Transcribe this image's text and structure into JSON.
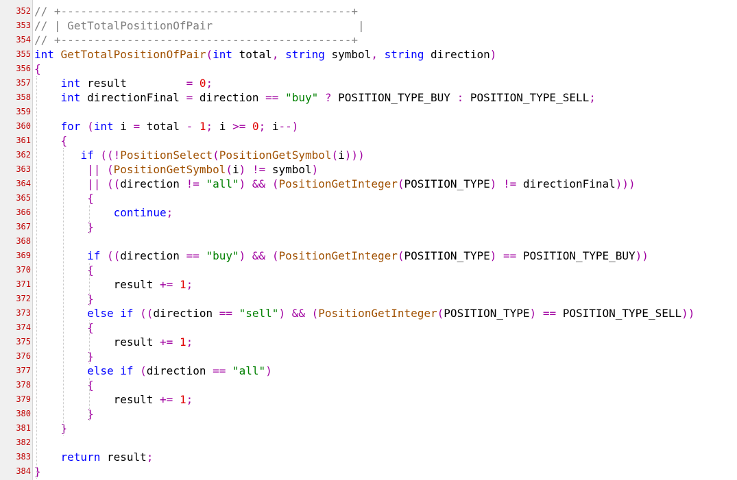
{
  "colors": {
    "line_number": "#c00000",
    "comment": "#808080",
    "keyword": "#0000ff",
    "type": "#0000ff",
    "function": "#a05000",
    "string": "#008000",
    "number": "#e00000",
    "operator": "#a000a0",
    "constant": "#000000",
    "plain": "#000000"
  },
  "code": {
    "lines": [
      {
        "n": "352",
        "tokens": [
          {
            "t": "// +--------------------------------------------+",
            "c": "comment"
          }
        ]
      },
      {
        "n": "353",
        "tokens": [
          {
            "t": "// | GetTotalPositionOfPair                      |",
            "c": "comment"
          }
        ]
      },
      {
        "n": "354",
        "tokens": [
          {
            "t": "// +--------------------------------------------+",
            "c": "comment"
          }
        ]
      },
      {
        "n": "355",
        "tokens": [
          {
            "t": "int",
            "c": "type"
          },
          {
            "t": " ",
            "c": "plain"
          },
          {
            "t": "GetTotalPositionOfPair",
            "c": "function"
          },
          {
            "t": "(",
            "c": "operator"
          },
          {
            "t": "int",
            "c": "type"
          },
          {
            "t": " total",
            "c": "plain"
          },
          {
            "t": ",",
            "c": "operator"
          },
          {
            "t": " ",
            "c": "plain"
          },
          {
            "t": "string",
            "c": "type"
          },
          {
            "t": " symbol",
            "c": "plain"
          },
          {
            "t": ",",
            "c": "operator"
          },
          {
            "t": " ",
            "c": "plain"
          },
          {
            "t": "string",
            "c": "type"
          },
          {
            "t": " direction",
            "c": "plain"
          },
          {
            "t": ")",
            "c": "operator"
          }
        ]
      },
      {
        "n": "356",
        "tokens": [
          {
            "t": "{",
            "c": "operator"
          }
        ]
      },
      {
        "n": "357",
        "tokens": [
          {
            "t": "    ",
            "c": "plain"
          },
          {
            "t": "int",
            "c": "type"
          },
          {
            "t": " result         ",
            "c": "plain"
          },
          {
            "t": "=",
            "c": "operator"
          },
          {
            "t": " ",
            "c": "plain"
          },
          {
            "t": "0",
            "c": "number"
          },
          {
            "t": ";",
            "c": "operator"
          }
        ]
      },
      {
        "n": "358",
        "tokens": [
          {
            "t": "    ",
            "c": "plain"
          },
          {
            "t": "int",
            "c": "type"
          },
          {
            "t": " directionFinal ",
            "c": "plain"
          },
          {
            "t": "=",
            "c": "operator"
          },
          {
            "t": " direction ",
            "c": "plain"
          },
          {
            "t": "==",
            "c": "operator"
          },
          {
            "t": " ",
            "c": "plain"
          },
          {
            "t": "\"buy\"",
            "c": "string"
          },
          {
            "t": " ",
            "c": "plain"
          },
          {
            "t": "?",
            "c": "operator"
          },
          {
            "t": " POSITION_TYPE_BUY ",
            "c": "constant"
          },
          {
            "t": ":",
            "c": "operator"
          },
          {
            "t": " POSITION_TYPE_SELL",
            "c": "constant"
          },
          {
            "t": ";",
            "c": "operator"
          }
        ]
      },
      {
        "n": "359",
        "tokens": []
      },
      {
        "n": "360",
        "tokens": [
          {
            "t": "    ",
            "c": "plain"
          },
          {
            "t": "for",
            "c": "keyword"
          },
          {
            "t": " ",
            "c": "plain"
          },
          {
            "t": "(",
            "c": "operator"
          },
          {
            "t": "int",
            "c": "type"
          },
          {
            "t": " i ",
            "c": "plain"
          },
          {
            "t": "=",
            "c": "operator"
          },
          {
            "t": " total ",
            "c": "plain"
          },
          {
            "t": "-",
            "c": "operator"
          },
          {
            "t": " ",
            "c": "plain"
          },
          {
            "t": "1",
            "c": "number"
          },
          {
            "t": ";",
            "c": "operator"
          },
          {
            "t": " i ",
            "c": "plain"
          },
          {
            "t": ">=",
            "c": "operator"
          },
          {
            "t": " ",
            "c": "plain"
          },
          {
            "t": "0",
            "c": "number"
          },
          {
            "t": ";",
            "c": "operator"
          },
          {
            "t": " i",
            "c": "plain"
          },
          {
            "t": "--)",
            "c": "operator"
          }
        ]
      },
      {
        "n": "361",
        "tokens": [
          {
            "t": "    ",
            "c": "plain"
          },
          {
            "t": "{",
            "c": "operator"
          }
        ]
      },
      {
        "n": "362",
        "tokens": [
          {
            "t": "       ",
            "c": "plain"
          },
          {
            "t": "if",
            "c": "keyword"
          },
          {
            "t": " ",
            "c": "plain"
          },
          {
            "t": "((!",
            "c": "operator"
          },
          {
            "t": "PositionSelect",
            "c": "function"
          },
          {
            "t": "(",
            "c": "operator"
          },
          {
            "t": "PositionGetSymbol",
            "c": "function"
          },
          {
            "t": "(",
            "c": "operator"
          },
          {
            "t": "i",
            "c": "plain"
          },
          {
            "t": ")))",
            "c": "operator"
          }
        ]
      },
      {
        "n": "363",
        "tokens": [
          {
            "t": "        ",
            "c": "plain"
          },
          {
            "t": "||",
            "c": "operator"
          },
          {
            "t": " ",
            "c": "plain"
          },
          {
            "t": "(",
            "c": "operator"
          },
          {
            "t": "PositionGetSymbol",
            "c": "function"
          },
          {
            "t": "(",
            "c": "operator"
          },
          {
            "t": "i",
            "c": "plain"
          },
          {
            "t": ")",
            "c": "operator"
          },
          {
            "t": " ",
            "c": "plain"
          },
          {
            "t": "!=",
            "c": "operator"
          },
          {
            "t": " symbol",
            "c": "plain"
          },
          {
            "t": ")",
            "c": "operator"
          }
        ]
      },
      {
        "n": "364",
        "tokens": [
          {
            "t": "        ",
            "c": "plain"
          },
          {
            "t": "||",
            "c": "operator"
          },
          {
            "t": " ",
            "c": "plain"
          },
          {
            "t": "((",
            "c": "operator"
          },
          {
            "t": "direction ",
            "c": "plain"
          },
          {
            "t": "!=",
            "c": "operator"
          },
          {
            "t": " ",
            "c": "plain"
          },
          {
            "t": "\"all\"",
            "c": "string"
          },
          {
            "t": ")",
            "c": "operator"
          },
          {
            "t": " ",
            "c": "plain"
          },
          {
            "t": "&&",
            "c": "operator"
          },
          {
            "t": " ",
            "c": "plain"
          },
          {
            "t": "(",
            "c": "operator"
          },
          {
            "t": "PositionGetInteger",
            "c": "function"
          },
          {
            "t": "(",
            "c": "operator"
          },
          {
            "t": "POSITION_TYPE",
            "c": "constant"
          },
          {
            "t": ")",
            "c": "operator"
          },
          {
            "t": " ",
            "c": "plain"
          },
          {
            "t": "!=",
            "c": "operator"
          },
          {
            "t": " directionFinal",
            "c": "plain"
          },
          {
            "t": ")))",
            "c": "operator"
          }
        ]
      },
      {
        "n": "365",
        "tokens": [
          {
            "t": "        ",
            "c": "plain"
          },
          {
            "t": "{",
            "c": "operator"
          }
        ]
      },
      {
        "n": "366",
        "tokens": [
          {
            "t": "            ",
            "c": "plain"
          },
          {
            "t": "continue",
            "c": "keyword"
          },
          {
            "t": ";",
            "c": "operator"
          }
        ]
      },
      {
        "n": "367",
        "tokens": [
          {
            "t": "        ",
            "c": "plain"
          },
          {
            "t": "}",
            "c": "operator"
          }
        ]
      },
      {
        "n": "368",
        "tokens": []
      },
      {
        "n": "369",
        "tokens": [
          {
            "t": "        ",
            "c": "plain"
          },
          {
            "t": "if",
            "c": "keyword"
          },
          {
            "t": " ",
            "c": "plain"
          },
          {
            "t": "((",
            "c": "operator"
          },
          {
            "t": "direction ",
            "c": "plain"
          },
          {
            "t": "==",
            "c": "operator"
          },
          {
            "t": " ",
            "c": "plain"
          },
          {
            "t": "\"buy\"",
            "c": "string"
          },
          {
            "t": ")",
            "c": "operator"
          },
          {
            "t": " ",
            "c": "plain"
          },
          {
            "t": "&&",
            "c": "operator"
          },
          {
            "t": " ",
            "c": "plain"
          },
          {
            "t": "(",
            "c": "operator"
          },
          {
            "t": "PositionGetInteger",
            "c": "function"
          },
          {
            "t": "(",
            "c": "operator"
          },
          {
            "t": "POSITION_TYPE",
            "c": "constant"
          },
          {
            "t": ")",
            "c": "operator"
          },
          {
            "t": " ",
            "c": "plain"
          },
          {
            "t": "==",
            "c": "operator"
          },
          {
            "t": " POSITION_TYPE_BUY",
            "c": "constant"
          },
          {
            "t": "))",
            "c": "operator"
          }
        ]
      },
      {
        "n": "370",
        "tokens": [
          {
            "t": "        ",
            "c": "plain"
          },
          {
            "t": "{",
            "c": "operator"
          }
        ]
      },
      {
        "n": "371",
        "tokens": [
          {
            "t": "            result ",
            "c": "plain"
          },
          {
            "t": "+=",
            "c": "operator"
          },
          {
            "t": " ",
            "c": "plain"
          },
          {
            "t": "1",
            "c": "number"
          },
          {
            "t": ";",
            "c": "operator"
          }
        ]
      },
      {
        "n": "372",
        "tokens": [
          {
            "t": "        ",
            "c": "plain"
          },
          {
            "t": "}",
            "c": "operator"
          }
        ]
      },
      {
        "n": "373",
        "tokens": [
          {
            "t": "        ",
            "c": "plain"
          },
          {
            "t": "else",
            "c": "keyword"
          },
          {
            "t": " ",
            "c": "plain"
          },
          {
            "t": "if",
            "c": "keyword"
          },
          {
            "t": " ",
            "c": "plain"
          },
          {
            "t": "((",
            "c": "operator"
          },
          {
            "t": "direction ",
            "c": "plain"
          },
          {
            "t": "==",
            "c": "operator"
          },
          {
            "t": " ",
            "c": "plain"
          },
          {
            "t": "\"sell\"",
            "c": "string"
          },
          {
            "t": ")",
            "c": "operator"
          },
          {
            "t": " ",
            "c": "plain"
          },
          {
            "t": "&&",
            "c": "operator"
          },
          {
            "t": " ",
            "c": "plain"
          },
          {
            "t": "(",
            "c": "operator"
          },
          {
            "t": "PositionGetInteger",
            "c": "function"
          },
          {
            "t": "(",
            "c": "operator"
          },
          {
            "t": "POSITION_TYPE",
            "c": "constant"
          },
          {
            "t": ")",
            "c": "operator"
          },
          {
            "t": " ",
            "c": "plain"
          },
          {
            "t": "==",
            "c": "operator"
          },
          {
            "t": " POSITION_TYPE_SELL",
            "c": "constant"
          },
          {
            "t": "))",
            "c": "operator"
          }
        ]
      },
      {
        "n": "374",
        "tokens": [
          {
            "t": "        ",
            "c": "plain"
          },
          {
            "t": "{",
            "c": "operator"
          }
        ]
      },
      {
        "n": "375",
        "tokens": [
          {
            "t": "            result ",
            "c": "plain"
          },
          {
            "t": "+=",
            "c": "operator"
          },
          {
            "t": " ",
            "c": "plain"
          },
          {
            "t": "1",
            "c": "number"
          },
          {
            "t": ";",
            "c": "operator"
          }
        ]
      },
      {
        "n": "376",
        "tokens": [
          {
            "t": "        ",
            "c": "plain"
          },
          {
            "t": "}",
            "c": "operator"
          }
        ]
      },
      {
        "n": "377",
        "tokens": [
          {
            "t": "        ",
            "c": "plain"
          },
          {
            "t": "else",
            "c": "keyword"
          },
          {
            "t": " ",
            "c": "plain"
          },
          {
            "t": "if",
            "c": "keyword"
          },
          {
            "t": " ",
            "c": "plain"
          },
          {
            "t": "(",
            "c": "operator"
          },
          {
            "t": "direction ",
            "c": "plain"
          },
          {
            "t": "==",
            "c": "operator"
          },
          {
            "t": " ",
            "c": "plain"
          },
          {
            "t": "\"all\"",
            "c": "string"
          },
          {
            "t": ")",
            "c": "operator"
          }
        ]
      },
      {
        "n": "378",
        "tokens": [
          {
            "t": "        ",
            "c": "plain"
          },
          {
            "t": "{",
            "c": "operator"
          }
        ]
      },
      {
        "n": "379",
        "tokens": [
          {
            "t": "            result ",
            "c": "plain"
          },
          {
            "t": "+=",
            "c": "operator"
          },
          {
            "t": " ",
            "c": "plain"
          },
          {
            "t": "1",
            "c": "number"
          },
          {
            "t": ";",
            "c": "operator"
          }
        ]
      },
      {
        "n": "380",
        "tokens": [
          {
            "t": "        ",
            "c": "plain"
          },
          {
            "t": "}",
            "c": "operator"
          }
        ]
      },
      {
        "n": "381",
        "tokens": [
          {
            "t": "    ",
            "c": "plain"
          },
          {
            "t": "}",
            "c": "operator"
          }
        ]
      },
      {
        "n": "382",
        "tokens": []
      },
      {
        "n": "383",
        "tokens": [
          {
            "t": "    ",
            "c": "plain"
          },
          {
            "t": "return",
            "c": "keyword"
          },
          {
            "t": " result",
            "c": "plain"
          },
          {
            "t": ";",
            "c": "operator"
          }
        ]
      },
      {
        "n": "384",
        "tokens": [
          {
            "t": "}",
            "c": "operator"
          }
        ]
      }
    ]
  }
}
